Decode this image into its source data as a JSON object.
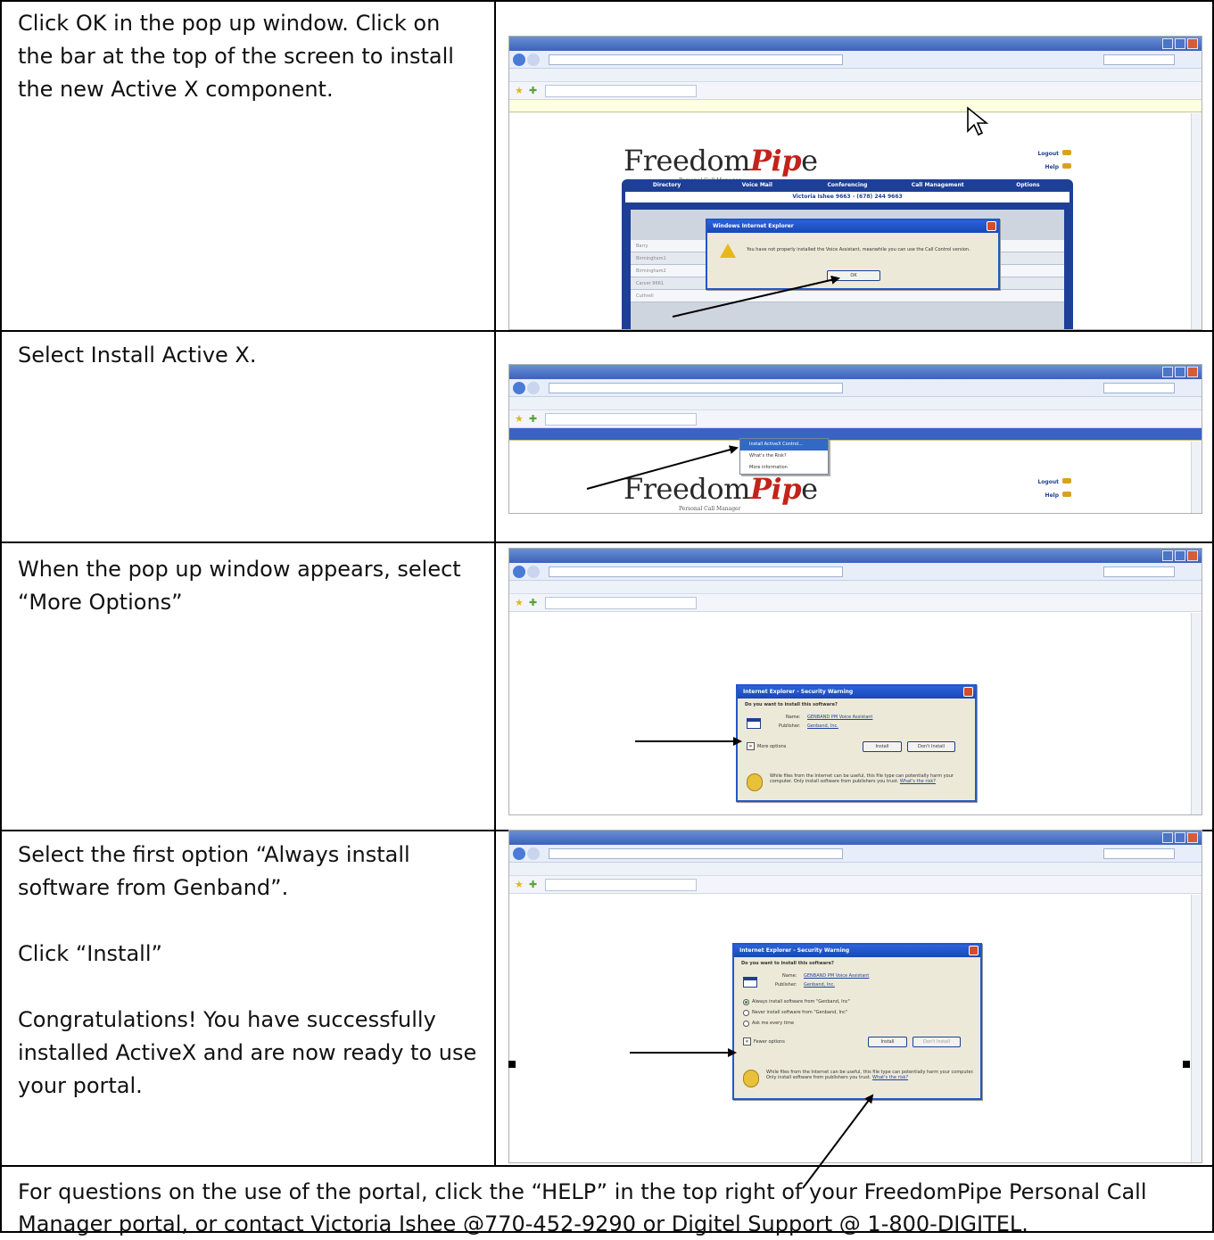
{
  "steps": [
    {
      "paragraphs": [
        "Click OK in the pop up window. Click on the bar at the top of the screen to install the new Active X component."
      ]
    },
    {
      "paragraphs": [
        "Select Install Active X."
      ]
    },
    {
      "paragraphs": [
        "When the pop up window appears, select “More Options”"
      ]
    },
    {
      "paragraphs": [
        "Select the first option “Always install software from Genband”.",
        "Click “Install”",
        "Congratulations! You have successfully installed ActiveX and are now ready to use your portal."
      ]
    }
  ],
  "footer": {
    "text": "For questions on the use of the portal, click the “HELP” in the top right of your FreedomPipe Personal Call Manager portal, or contact Victoria Ishee @770-452-9290 or Digitel Support @ 1-800-DIGITEL."
  },
  "screens": {
    "brand": {
      "logo_plain": "Freedom",
      "logo_p": "P",
      "logo_accent": "ip",
      "logo_end": "e",
      "subtitle": "Personal Call Manager"
    },
    "shot1": {
      "nav_tabs": [
        "Directory",
        "Voice Mail",
        "Conferencing",
        "Call Management",
        "Options"
      ],
      "user_line": "Victoria Ishee 9663 - (678) 244 9663",
      "side_links": [
        "Logout",
        "Help"
      ],
      "dialog_title": "Windows Internet Explorer",
      "dialog_message": "You have not properly installed the Voice Assistant, meanwhile you can use the Call Control version.",
      "dialog_ok": "OK",
      "rows": [
        "Barry",
        "Birmingham1",
        "Birmingham2",
        "Carver 9661",
        "Cuthrell"
      ]
    },
    "shot2": {
      "menu_items": [
        "Install ActiveX Control...",
        "What's the Risk?",
        "More information"
      ],
      "side_links": [
        "Logout",
        "Help"
      ]
    },
    "security_dialog": {
      "title": "Internet Explorer - Security Warning",
      "question": "Do you want to install this software?",
      "name_label": "Name:",
      "name_value": "GENBAND PM Voice Assistant",
      "publisher_label": "Publisher:",
      "publisher_value": "Genband, Inc.",
      "more_options": "More options",
      "fewer_options": "Fewer options",
      "install": "Install",
      "dont_install": "Don't Install",
      "options": [
        "Always install software from \"Genband, Inc\"",
        "Never install software from \"Genband, Inc\"",
        "Ask me every time"
      ],
      "warning_text": "While files from the Internet can be useful, this file type can potentially harm your computer. Only install software from publishers you trust.",
      "warning_link": "What's the risk?"
    }
  }
}
